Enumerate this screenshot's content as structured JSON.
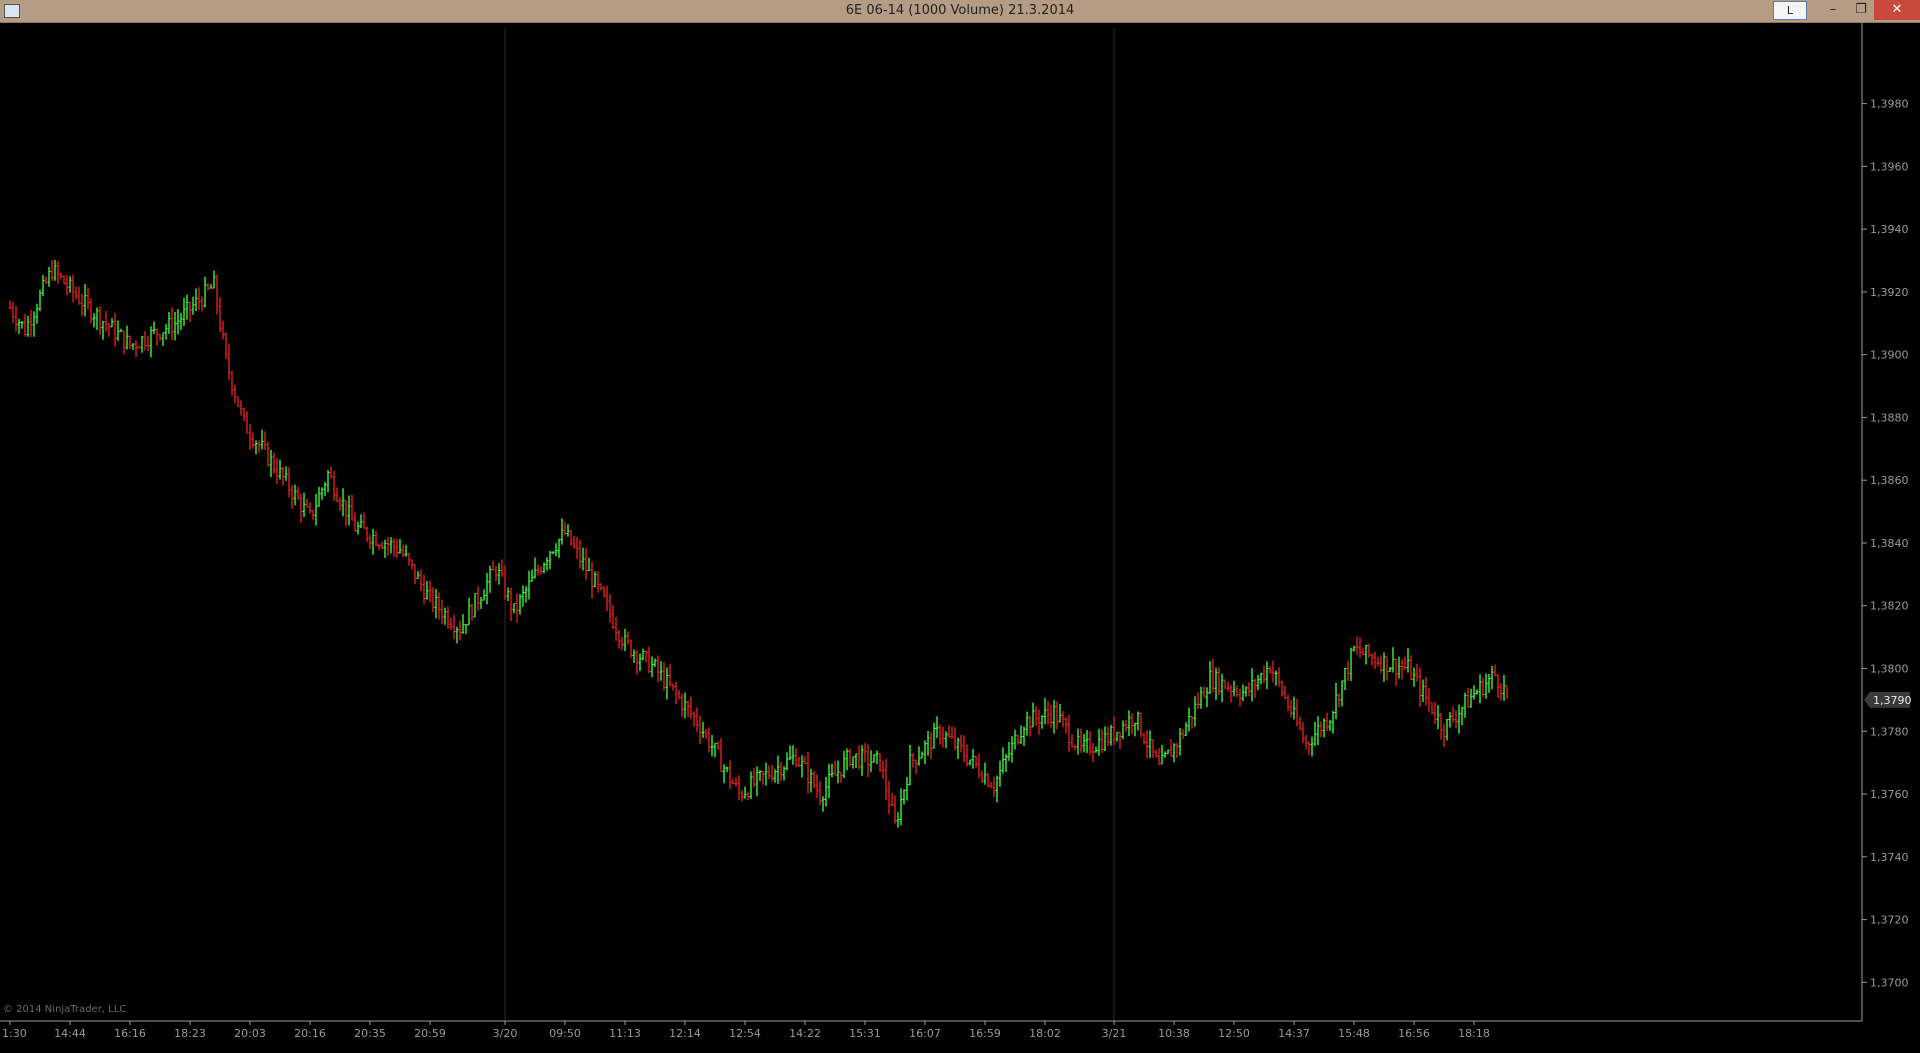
{
  "window": {
    "title": "6E 06-14 (1000 Volume)  21.3.2014",
    "l_button": "L",
    "minimize": "–",
    "restore": "❐",
    "close": "✕"
  },
  "colors": {
    "background": "#000000",
    "up_bar": "#3cf23c",
    "down_bar": "#e01e1e",
    "axis": "#9a9a9a",
    "titlebar": "#b59c85"
  },
  "copyright": "© 2014 NinjaTrader, LLC",
  "price_marker": "1,3790",
  "chart_data": {
    "type": "ohlc-bar",
    "instrument": "6E 06-14",
    "bar_type": "1000 Volume",
    "date": "21.3.2014",
    "y_ticks": [
      "1,3980",
      "1,3960",
      "1,3940",
      "1,3920",
      "1,3900",
      "1,3880",
      "1,3860",
      "1,3840",
      "1,3820",
      "1,3800",
      "1,3780",
      "1,3760",
      "1,3740",
      "1,3720",
      "1,3700"
    ],
    "y_tick_values": [
      1.398,
      1.396,
      1.394,
      1.392,
      1.39,
      1.388,
      1.386,
      1.384,
      1.382,
      1.38,
      1.378,
      1.376,
      1.374,
      1.372,
      1.37
    ],
    "ylim": [
      1.3688,
      1.4006
    ],
    "x_ticks": [
      "1:30",
      "14:44",
      "16:16",
      "18:23",
      "20:03",
      "20:16",
      "20:35",
      "20:59",
      "3/20",
      "09:50",
      "11:13",
      "12:14",
      "12:54",
      "14:22",
      "15:31",
      "16:07",
      "16:59",
      "18:02",
      "3/21",
      "10:38",
      "12:50",
      "14:37",
      "15:48",
      "16:56",
      "18:18"
    ],
    "x_tick_bar_index": [
      0,
      20,
      40,
      60,
      80,
      100,
      120,
      140,
      165,
      185,
      205,
      225,
      245,
      265,
      285,
      305,
      325,
      345,
      368,
      388,
      408,
      428,
      448,
      468,
      488
    ],
    "session_breaks_bar_index": [
      165,
      368
    ],
    "bar_count": 500,
    "path_points": [
      [
        0,
        1.3915
      ],
      [
        5,
        1.3908
      ],
      [
        14,
        1.3927
      ],
      [
        25,
        1.3916
      ],
      [
        40,
        1.3903
      ],
      [
        55,
        1.391
      ],
      [
        68,
        1.3922
      ],
      [
        72,
        1.3898
      ],
      [
        78,
        1.3878
      ],
      [
        90,
        1.3862
      ],
      [
        100,
        1.3848
      ],
      [
        106,
        1.3862
      ],
      [
        115,
        1.3845
      ],
      [
        130,
        1.3838
      ],
      [
        140,
        1.3822
      ],
      [
        150,
        1.3813
      ],
      [
        162,
        1.3832
      ],
      [
        168,
        1.3818
      ],
      [
        180,
        1.3838
      ],
      [
        185,
        1.3843
      ],
      [
        195,
        1.3827
      ],
      [
        205,
        1.3808
      ],
      [
        215,
        1.38
      ],
      [
        230,
        1.3782
      ],
      [
        243,
        1.376
      ],
      [
        255,
        1.3768
      ],
      [
        262,
        1.3772
      ],
      [
        270,
        1.376
      ],
      [
        280,
        1.3772
      ],
      [
        290,
        1.377
      ],
      [
        295,
        1.375
      ],
      [
        300,
        1.377
      ],
      [
        310,
        1.378
      ],
      [
        318,
        1.3773
      ],
      [
        328,
        1.3763
      ],
      [
        338,
        1.3783
      ],
      [
        348,
        1.3786
      ],
      [
        357,
        1.3774
      ],
      [
        366,
        1.3778
      ],
      [
        375,
        1.3785
      ],
      [
        383,
        1.3768
      ],
      [
        390,
        1.3778
      ],
      [
        400,
        1.3797
      ],
      [
        412,
        1.3792
      ],
      [
        420,
        1.3801
      ],
      [
        432,
        1.3776
      ],
      [
        440,
        1.3785
      ],
      [
        448,
        1.3806
      ],
      [
        458,
        1.3802
      ],
      [
        466,
        1.38
      ],
      [
        478,
        1.3781
      ],
      [
        488,
        1.3792
      ],
      [
        495,
        1.3798
      ],
      [
        500,
        1.379
      ]
    ],
    "last_price": 1.379
  }
}
